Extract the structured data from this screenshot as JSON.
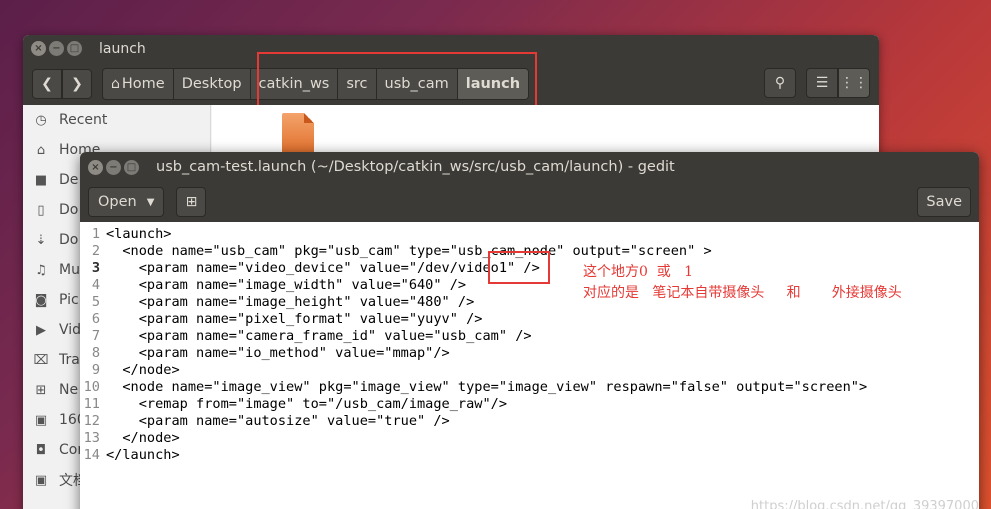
{
  "files": {
    "title": "launch",
    "breadcrumb": [
      "Home",
      "Desktop",
      "catkin_ws",
      "src",
      "usb_cam",
      "launch"
    ],
    "sidebar": [
      "Recent",
      "Home",
      "De",
      "Do",
      "Do",
      "Mu",
      "Pic",
      "Vid",
      "Tra",
      "Ne",
      "160",
      "Cor",
      "文档"
    ]
  },
  "gedit": {
    "title": "usb_cam-test.launch (~/Desktop/catkin_ws/src/usb_cam/launch) - gedit",
    "open_label": "Open",
    "save_label": "Save",
    "lines": [
      "<launch>",
      "  <node name=\"usb_cam\" pkg=\"usb_cam\" type=\"usb_cam_node\" output=\"screen\" >",
      "    <param name=\"video_device\" value=\"/dev/video1\" />",
      "    <param name=\"image_width\" value=\"640\" />",
      "    <param name=\"image_height\" value=\"480\" />",
      "    <param name=\"pixel_format\" value=\"yuyv\" />",
      "    <param name=\"camera_frame_id\" value=\"usb_cam\" />",
      "    <param name=\"io_method\" value=\"mmap\"/>",
      "  </node>",
      "  <node name=\"image_view\" pkg=\"image_view\" type=\"image_view\" respawn=\"false\" output=\"screen\">",
      "    <remap from=\"image\" to=\"/usb_cam/image_raw\"/>",
      "    <param name=\"autosize\" value=\"true\" />",
      "  </node>",
      "</launch>"
    ],
    "line_numbers": [
      "1",
      "2",
      "3",
      "4",
      "5",
      "6",
      "7",
      "8",
      "9",
      "10",
      "11",
      "12",
      "13",
      "14"
    ],
    "annotation_line1": "这个地方0  或   1",
    "annotation_line2": "对应的是   笔记本自带摄像头     和       外接摄像头"
  },
  "watermark": "https://blog.csdn.net/qq_39397000"
}
